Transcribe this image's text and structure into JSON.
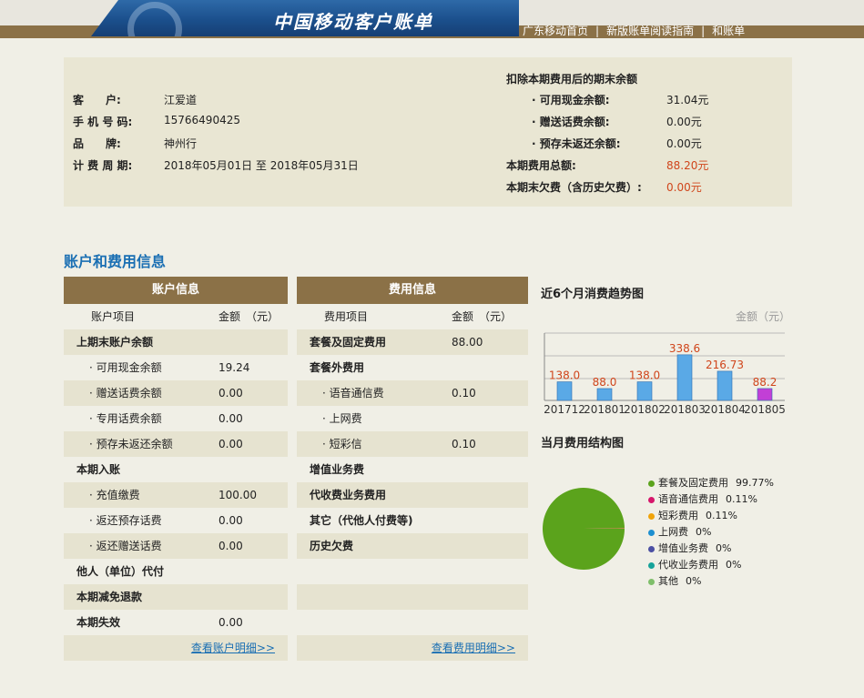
{
  "header": {
    "title": "中国移动客户账单",
    "nav": [
      "广东移动首页",
      "新版账单阅读指南",
      "和账单"
    ]
  },
  "customer": {
    "fields": [
      {
        "label": "客　　户:",
        "value": "江爱道"
      },
      {
        "label": "手 机 号 码:",
        "value": "15766490425"
      },
      {
        "label": "品　　牌:",
        "value": "神州行"
      },
      {
        "label": "计 费 周 期:",
        "value": "2018年05月01日 至 2018年05月31日"
      }
    ]
  },
  "balance": {
    "heading": "扣除本期费用后的期末余额",
    "cash_label": "· 可用现金余额:",
    "cash_value": "31.04元",
    "gift_label": "· 赠送话费余额:",
    "gift_value": "0.00元",
    "prepay_label": "· 预存未返还余额:",
    "prepay_value": "0.00元",
    "total_label": "本期费用总额:",
    "total_value": "88.20元",
    "owed_label": "本期末欠费（含历史欠费）:",
    "owed_value": "0.00元"
  },
  "section_title": "账户和费用信息",
  "account": {
    "header": "账户信息",
    "col1": "账户项目",
    "col2": "金额　（元）",
    "rows": [
      {
        "label": "上期末账户余额",
        "value": ""
      },
      {
        "label": "· 可用现金余额",
        "value": "19.24"
      },
      {
        "label": "· 赠送话费余额",
        "value": "0.00"
      },
      {
        "label": "· 专用话费余额",
        "value": "0.00"
      },
      {
        "label": "· 预存未返还余额",
        "value": "0.00"
      },
      {
        "label": "本期入账",
        "value": ""
      },
      {
        "label": "· 充值缴费",
        "value": "100.00"
      },
      {
        "label": "· 返还预存话费",
        "value": "0.00"
      },
      {
        "label": "· 返还赠送话费",
        "value": "0.00"
      },
      {
        "label": "他人（单位）代付",
        "value": ""
      },
      {
        "label": "本期减免退款",
        "value": ""
      },
      {
        "label": "本期失效",
        "value": "0.00"
      }
    ],
    "link": "查看账户明细>>"
  },
  "fee": {
    "header": "费用信息",
    "col1": "费用项目",
    "col2": "金额　（元）",
    "rows": [
      {
        "label": "套餐及固定费用",
        "value": "88.00"
      },
      {
        "label": "套餐外费用",
        "value": ""
      },
      {
        "label": "· 语音通信费",
        "value": "0.10"
      },
      {
        "label": "· 上网费",
        "value": ""
      },
      {
        "label": "· 短彩信",
        "value": "0.10"
      },
      {
        "label": "增值业务费",
        "value": ""
      },
      {
        "label": "代收费业务费用",
        "value": ""
      },
      {
        "label": "其它（代他人付费等)",
        "value": ""
      },
      {
        "label": "历史欠费",
        "value": ""
      },
      {
        "label": "",
        "value": ""
      },
      {
        "label": "",
        "value": ""
      },
      {
        "label": "",
        "value": ""
      }
    ],
    "link": "查看费用明细>>"
  },
  "trend": {
    "title": "近6个月消费趋势图",
    "unit": "金额（元）",
    "chart_data": {
      "type": "bar",
      "categories": [
        "201712",
        "201801",
        "201802",
        "201803",
        "201804",
        "201805"
      ],
      "values": [
        138.0,
        88.0,
        138.0,
        338.6,
        216.73,
        88.2
      ],
      "value_labels": [
        "138.0",
        "88.0",
        "138.0",
        "338.6",
        "216.73",
        "88.2"
      ],
      "ylabel": "金额（元）",
      "colors": [
        "#5aa9e6",
        "#5aa9e6",
        "#5aa9e6",
        "#5aa9e6",
        "#5aa9e6",
        "#c23fd6"
      ]
    }
  },
  "structure": {
    "title": "当月费用结构图",
    "chart_data": {
      "type": "pie",
      "categories": [
        "套餐及固定费用",
        "语音通信费用",
        "短彩费用",
        "上网费",
        "增值业务费",
        "代收业务费用",
        "其他"
      ],
      "values": [
        99.77,
        0.11,
        0.11,
        0,
        0,
        0,
        0
      ],
      "percent_labels": [
        "99.77%",
        "0.11%",
        "0.11%",
        "0%",
        "0%",
        "0%",
        "0%"
      ],
      "colors": [
        "#5ba31c",
        "#d6166b",
        "#f0a30a",
        "#1d8fd0",
        "#4b4fa3",
        "#17a39a",
        "#7fbf6a"
      ]
    }
  }
}
